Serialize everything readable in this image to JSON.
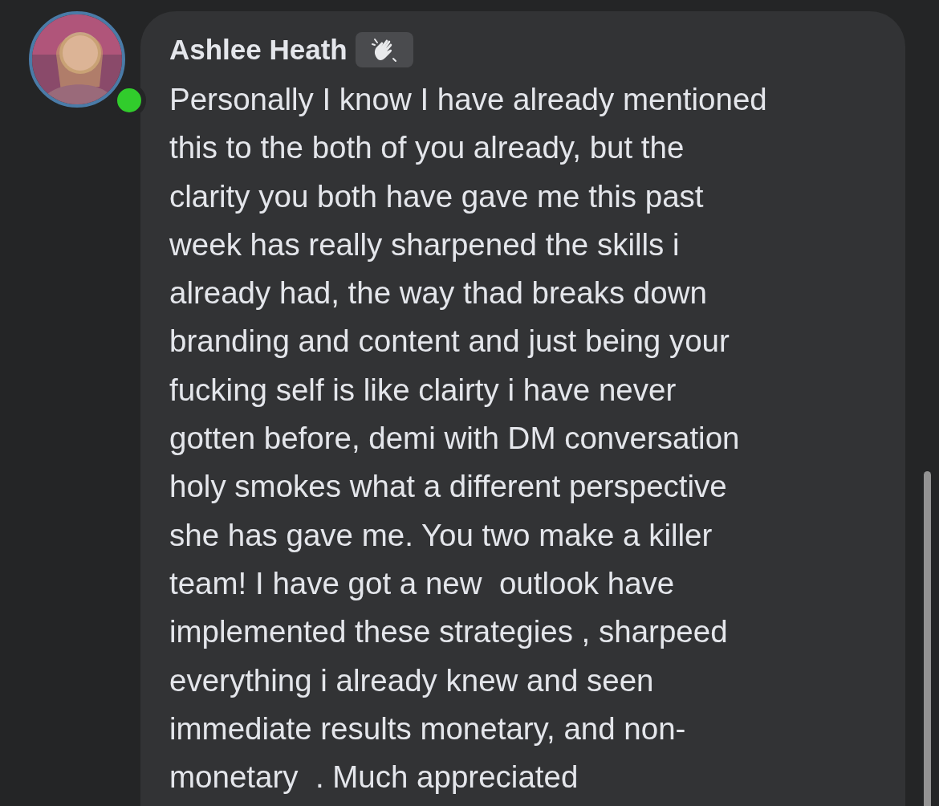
{
  "comment": {
    "author": "Ashlee Heath",
    "online": true,
    "badge": {
      "kind": "wave"
    },
    "lines": [
      "Personally I know I have already mentioned",
      "this to the both of you already, but the",
      "clarity you both have gave me this past",
      "week has really sharpened the skills i",
      "already had, the way thad breaks down",
      "branding and content and just being your",
      "fucking self is like clairty i have never",
      "gotten before, demi with DM conversation",
      "holy smokes what a different perspective",
      "she has gave me. You two make a killer",
      "team! I have got a new  outlook have",
      "implemented these strategies , sharpeed",
      "everything i already knew and seen",
      "immediate results monetary, and non-",
      "monetary  . Much appreciated"
    ]
  }
}
